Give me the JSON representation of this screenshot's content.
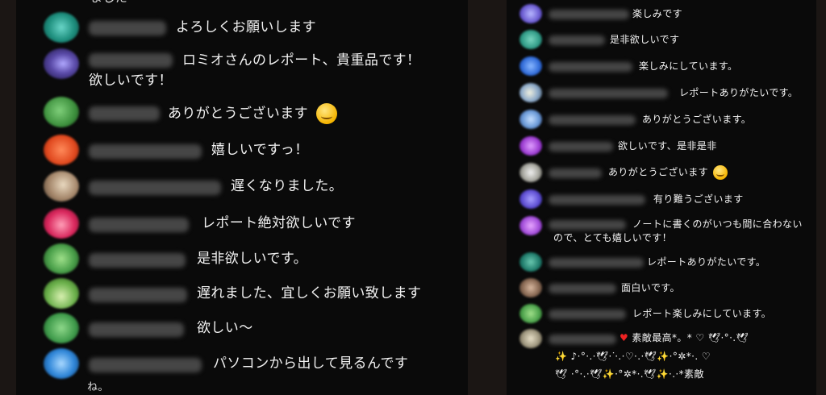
{
  "left": {
    "partial_top": "ました",
    "messages": [
      {
        "text": "よろしくお願いします"
      },
      {
        "text": "ロミオさんのレポート、貴重品です！",
        "text2": "欲しいです！"
      },
      {
        "text": "ありがとうございます"
      },
      {
        "text": "嬉しいですっ！"
      },
      {
        "text": "遅くなりました。"
      },
      {
        "text": "レポート絶対欲しいです"
      },
      {
        "text": "是非欲しいです。"
      },
      {
        "text": "遅れました、宜しくお願い致します"
      },
      {
        "text": "欲しい〜"
      },
      {
        "text": "パソコンから出して見るんです"
      }
    ],
    "partial_bottom": "ね。"
  },
  "right": {
    "messages": [
      {
        "text": "楽しみです"
      },
      {
        "text": "是非欲しいです"
      },
      {
        "text": "楽しみにしています。"
      },
      {
        "text": "レポートありがたいです。"
      },
      {
        "text": "ありがとうございます。"
      },
      {
        "text": "欲しいです、是非是非"
      },
      {
        "text": "ありがとうございます"
      },
      {
        "text": "有り難うございます"
      },
      {
        "text": "ノートに書くのがいつも間に合わないので、とても嬉しいです！"
      },
      {
        "text": "レポートありがたいです。"
      },
      {
        "text": "面白いです。"
      },
      {
        "text": "レポート楽しみにしています。"
      },
      {
        "text": "素敵最高*。*",
        "text2": "素敵"
      }
    ]
  },
  "icons": {
    "smile": "smiling-face-emoji",
    "heart": "red-heart-emoji",
    "sparkles": "sparkles-emoji",
    "dove": "dove-emoji",
    "white_heart": "white-heart-emoji"
  }
}
